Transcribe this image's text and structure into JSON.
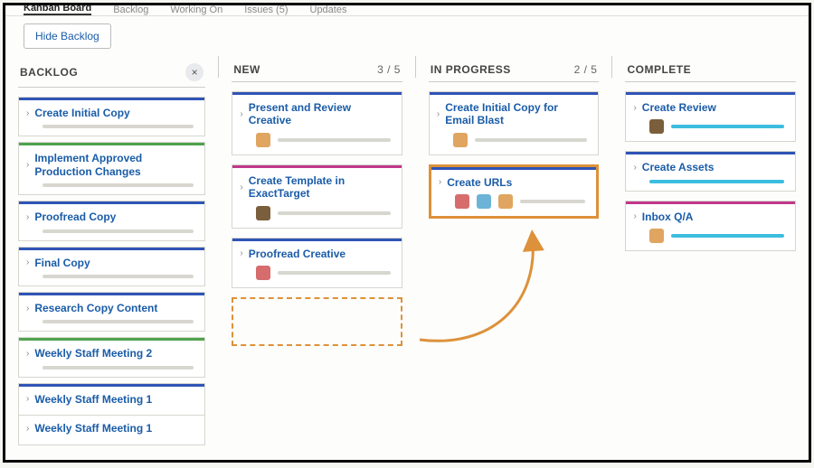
{
  "tabs": {
    "kanban": "Kanban Board",
    "backlog": "Backlog",
    "working": "Working On",
    "issues": "Issues (5)",
    "updates": "Updates"
  },
  "hide_backlog_btn": "Hide Backlog",
  "columns": {
    "backlog": {
      "label": "BACKLOG"
    },
    "new": {
      "label": "NEW",
      "count": "3 / 5"
    },
    "in_progress": {
      "label": "IN PROGRESS",
      "count": "2 / 5"
    },
    "complete": {
      "label": "COMPLETE"
    }
  },
  "backlog_cards": [
    {
      "title": "Create Initial Copy",
      "accent": "blue"
    },
    {
      "title": "Implement Approved Production Changes",
      "accent": "green"
    },
    {
      "title": "Proofread Copy",
      "accent": "blue"
    },
    {
      "title": "Final Copy",
      "accent": "blue"
    },
    {
      "title": "Research Copy Content",
      "accent": "blue"
    },
    {
      "title": "Weekly Staff Meeting 2",
      "accent": "green"
    },
    {
      "title": "Weekly Staff Meeting 1",
      "accent": "blue"
    },
    {
      "title": "Weekly Staff Meeting 1",
      "accent": "blue"
    }
  ],
  "new_cards": [
    {
      "title": "Present and Review Creative",
      "accent": "blue",
      "avatars": [
        "av1"
      ]
    },
    {
      "title": "Create Template in ExactTarget",
      "accent": "pink",
      "avatars": [
        "av2"
      ]
    },
    {
      "title": "Proofread Creative",
      "accent": "blue",
      "avatars": [
        "av3"
      ]
    }
  ],
  "prog_cards": [
    {
      "title": "Create Initial Copy for Email Blast",
      "accent": "blue",
      "avatars": [
        "av1"
      ],
      "highlight": false
    },
    {
      "title": "Create URLs",
      "accent": "blue",
      "avatars": [
        "av3",
        "av4",
        "av1"
      ],
      "highlight": true
    }
  ],
  "complete_cards": [
    {
      "title": "Create Review",
      "accent": "blue",
      "avatars": [
        "av2"
      ],
      "cyan": true
    },
    {
      "title": "Create Assets",
      "accent": "blue",
      "avatars": [],
      "cyan": true
    },
    {
      "title": "Inbox Q/A",
      "accent": "pink",
      "avatars": [
        "av1"
      ],
      "cyan": true
    }
  ],
  "colors": {
    "accent_orange": "#dd913a",
    "link_blue": "#1a5ca8"
  }
}
